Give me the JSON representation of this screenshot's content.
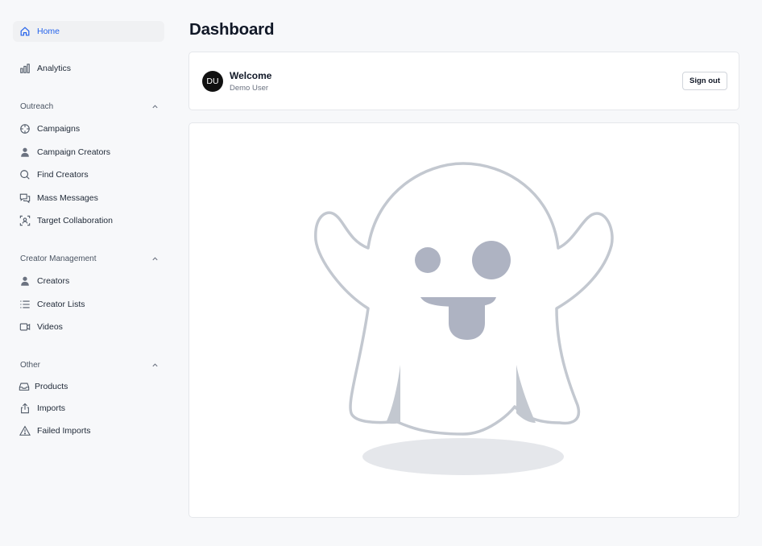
{
  "sidebar": {
    "home": {
      "label": "Home",
      "icon": "home-icon"
    },
    "analytics": {
      "label": "Analytics",
      "icon": "bar-chart-icon"
    },
    "outreach": {
      "title": "Outreach",
      "items": [
        {
          "label": "Campaigns",
          "icon": "crosshair-icon"
        },
        {
          "label": "Campaign Creators",
          "icon": "user-icon"
        },
        {
          "label": "Find Creators",
          "icon": "search-icon"
        },
        {
          "label": "Mass Messages",
          "icon": "messages-icon"
        },
        {
          "label": "Target Collaboration",
          "icon": "user-scan-icon"
        }
      ]
    },
    "creator_management": {
      "title": "Creator Management",
      "items": [
        {
          "label": "Creators",
          "icon": "user-icon"
        },
        {
          "label": "Creator Lists",
          "icon": "list-icon"
        },
        {
          "label": "Videos",
          "icon": "video-icon"
        }
      ]
    },
    "other": {
      "title": "Other",
      "items": [
        {
          "label": "Products",
          "icon": "inbox-icon"
        },
        {
          "label": "Imports",
          "icon": "upload-icon"
        },
        {
          "label": "Failed Imports",
          "icon": "warning-icon"
        }
      ]
    }
  },
  "main": {
    "title": "Dashboard",
    "welcome": {
      "avatar_initials": "DU",
      "title": "Welcome",
      "subtitle": "Demo User",
      "sign_out_label": "Sign out"
    },
    "empty_state_illustration": "ghost-illustration"
  },
  "colors": {
    "accent": "#2563eb",
    "background": "#f7f8fa",
    "ghost_outline": "#c3c8d0",
    "ghost_features": "#aeb3c2"
  }
}
